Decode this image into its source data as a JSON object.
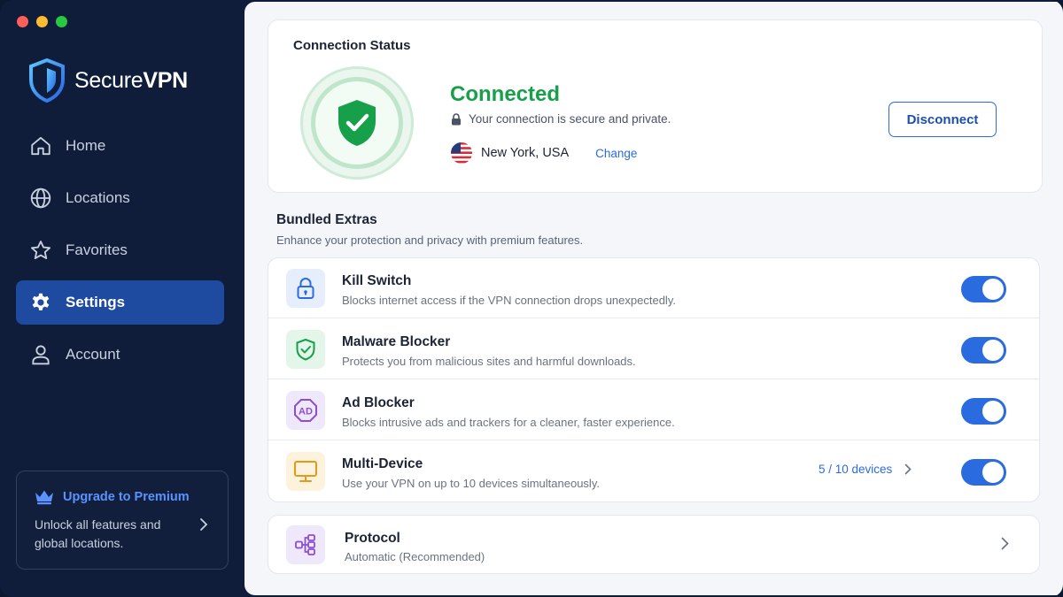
{
  "app": {
    "brand_light": "Secure",
    "brand_bold": "VPN",
    "accent_color": "#2a6be0",
    "connected_color": "#17a04a"
  },
  "sidebar": {
    "items": [
      {
        "label": "Home",
        "icon": "home-icon",
        "active": false
      },
      {
        "label": "Locations",
        "icon": "globe-icon",
        "active": false
      },
      {
        "label": "Favorites",
        "icon": "star-icon",
        "active": false
      },
      {
        "label": "Settings",
        "icon": "gear-icon",
        "active": true
      },
      {
        "label": "Account",
        "icon": "user-icon",
        "active": false
      }
    ],
    "premium": {
      "title": "Upgrade to Premium",
      "description": "Unlock all features and global locations.",
      "icon": "crown-icon"
    }
  },
  "connection": {
    "title": "Connection Status",
    "status": "Connected",
    "secure_text": "Your connection is secure and private.",
    "location": "New York, USA",
    "change_label": "Change",
    "disconnect_label": "Disconnect"
  },
  "extras": {
    "title": "Bundled Extras",
    "subtitle": "Enhance your protection and privacy with premium features.",
    "features": [
      {
        "name": "Kill Switch",
        "description": "Blocks internet access if the VPN connection drops unexpectedly.",
        "icon": "lock-icon",
        "enabled": true
      },
      {
        "name": "Malware Blocker",
        "description": "Protects you from malicious sites and harmful downloads.",
        "icon": "shield-check-icon",
        "enabled": true
      },
      {
        "name": "Ad Blocker",
        "description": "Blocks intrusive ads and trackers for a cleaner, faster experience.",
        "icon": "ad-block-icon",
        "enabled": true
      },
      {
        "name": "Multi-Device",
        "description": "Use your VPN on up to 10 devices simultaneously.",
        "icon": "monitor-icon",
        "enabled": true,
        "devices_label": "5 / 10 devices"
      }
    ]
  },
  "protocol": {
    "name": "Protocol",
    "value": "Automatic (Recommended)",
    "icon": "network-icon"
  }
}
